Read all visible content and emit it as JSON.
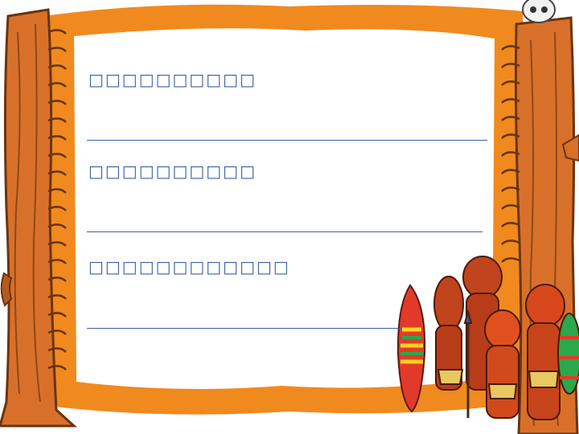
{
  "slide": {
    "lines": [
      {
        "text": "□□□□□□□□□□"
      },
      {
        "text": "□□□□□□□□□□"
      },
      {
        "text": "□□□□□□□□□□□□"
      }
    ]
  },
  "decor": {
    "frame_color": "#f08a1e",
    "wood_color": "#d9702a",
    "text_color": "#3a5fa8",
    "icons": [
      "skull-icon",
      "surfboard-icon",
      "tribal-figures-icon",
      "spiral-binding-icon"
    ]
  }
}
